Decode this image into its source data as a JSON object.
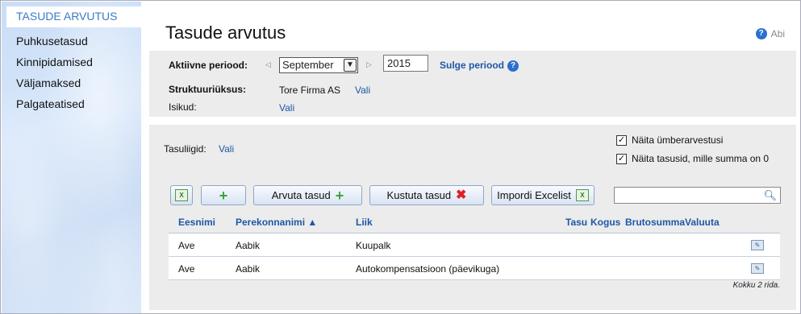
{
  "sidebar": {
    "items": [
      {
        "label": "TASUDE ARVUTUS",
        "active": true
      },
      {
        "label": "Puhkusetasud"
      },
      {
        "label": "Kinnipidamised"
      },
      {
        "label": "Väljamaksed"
      },
      {
        "label": "Palgateatised"
      }
    ]
  },
  "header": {
    "title": "Tasude arvutus",
    "help_label": "Abi",
    "help_icon": "question-icon"
  },
  "period": {
    "label": "Aktiivne periood:",
    "month": "September",
    "year": "2015",
    "close_link": "Sulge periood"
  },
  "structure": {
    "label": "Struktuuriüksus:",
    "value": "Tore Firma AS",
    "choose": "Vali"
  },
  "persons": {
    "label": "Isikud:",
    "choose": "Vali"
  },
  "pay_types": {
    "label": "Tasuliigid:",
    "choose": "Vali"
  },
  "options": {
    "show_recalc": "Näita ümberarvestusi",
    "show_zero": "Näita tasusid, mille summa on 0"
  },
  "toolbar": {
    "calculate": "Arvuta tasud",
    "delete": "Kustuta tasud",
    "import": "Impordi Excelist",
    "search_placeholder": ""
  },
  "table": {
    "columns": [
      "Eesnimi",
      "Perekonnanimi ▲",
      "Liik",
      "Tasu",
      "Kogus",
      "Brutosumma",
      "Valuuta"
    ],
    "rows": [
      {
        "first": "Ave",
        "last": "Aabik",
        "type": "Kuupalk"
      },
      {
        "first": "Ave",
        "last": "Aabik",
        "type": "Autokompensatsioon (päevikuga)"
      }
    ],
    "total": "Kokku 2 rida."
  }
}
